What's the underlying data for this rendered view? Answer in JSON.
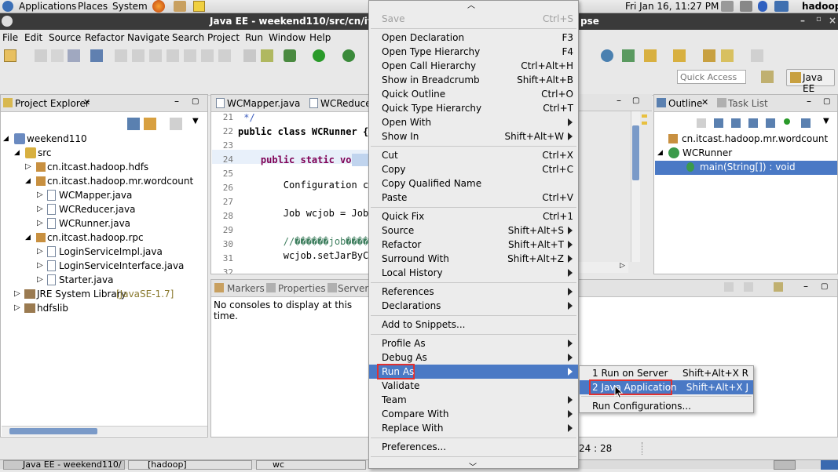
{
  "topbar": {
    "menus": [
      "Applications",
      "Places",
      "System"
    ],
    "datetime": "Fri Jan 16, 11:27 PM",
    "user": "hadoop"
  },
  "window": {
    "title_left": "Java EE - weekend110/src/cn/itcas",
    "title_right": "pse"
  },
  "menubar": [
    "File",
    "Edit",
    "Source",
    "Refactor",
    "Navigate",
    "Search",
    "Project",
    "Run",
    "Window",
    "Help"
  ],
  "toolbar": {
    "quick_access_placeholder": "Quick Access",
    "perspective": "Java EE"
  },
  "project_explorer": {
    "title": "Project Explorer",
    "items": [
      {
        "label": "weekend110"
      },
      {
        "label": "src"
      },
      {
        "label": "cn.itcast.hadoop.hdfs"
      },
      {
        "label": "cn.itcast.hadoop.mr.wordcount"
      },
      {
        "label": "WCMapper.java"
      },
      {
        "label": "WCReducer.java"
      },
      {
        "label": "WCRunner.java"
      },
      {
        "label": "cn.itcast.hadoop.rpc"
      },
      {
        "label": "LoginServiceImpl.java"
      },
      {
        "label": "LoginServiceInterface.java"
      },
      {
        "label": "Starter.java"
      },
      {
        "label": "JRE System Library",
        "suffix": "[JavaSE-1.7]"
      },
      {
        "label": "hdfslib"
      }
    ]
  },
  "editor": {
    "tabs": [
      "WCMapper.java",
      "WCReducer.ja"
    ],
    "lines": [
      {
        "no": "21",
        "text": " */"
      },
      {
        "no": "22",
        "text": "public class WCRunner {"
      },
      {
        "no": "23",
        "text": ""
      },
      {
        "no": "24",
        "text": "    public static void mai"
      },
      {
        "no": "25",
        "text": ""
      },
      {
        "no": "26",
        "text": "        Configuration conf"
      },
      {
        "no": "27",
        "text": ""
      },
      {
        "no": "28",
        "text": "        Job wcjob = Job.ge"
      },
      {
        "no": "29",
        "text": ""
      },
      {
        "no": "30",
        "text": "        //������job����"
      },
      {
        "no": "31",
        "text": "        wcjob.setJarByClas"
      },
      {
        "no": "32",
        "text": ""
      }
    ]
  },
  "bottom_panel": {
    "tabs": [
      "Markers",
      "Properties",
      "Servers"
    ],
    "message": "No consoles to display at this time."
  },
  "outline": {
    "tabs": [
      "Outline",
      "Task List"
    ],
    "items": [
      "cn.itcast.hadoop.mr.wordcount",
      "WCRunner",
      "main(String[]) : void"
    ]
  },
  "status": {
    "position": "24 : 28"
  },
  "taskbar": [
    "Java EE - weekend110/",
    "[hadoop]",
    "wc"
  ],
  "context_menu": {
    "items": [
      {
        "label": "Save",
        "shortcut": "Ctrl+S",
        "disabled": true
      },
      {
        "label": "Open Declaration",
        "shortcut": "F3"
      },
      {
        "label": "Open Type Hierarchy",
        "shortcut": "F4"
      },
      {
        "label": "Open Call Hierarchy",
        "shortcut": "Ctrl+Alt+H"
      },
      {
        "label": "Show in Breadcrumb",
        "shortcut": "Shift+Alt+B"
      },
      {
        "label": "Quick Outline",
        "shortcut": "Ctrl+O"
      },
      {
        "label": "Quick Type Hierarchy",
        "shortcut": "Ctrl+T"
      },
      {
        "label": "Open With",
        "shortcut": ""
      },
      {
        "label": "Show In",
        "shortcut": "Shift+Alt+W"
      },
      {
        "label": "Cut",
        "shortcut": "Ctrl+X"
      },
      {
        "label": "Copy",
        "shortcut": "Ctrl+C"
      },
      {
        "label": "Copy Qualified Name",
        "shortcut": ""
      },
      {
        "label": "Paste",
        "shortcut": "Ctrl+V"
      },
      {
        "label": "Quick Fix",
        "shortcut": "Ctrl+1"
      },
      {
        "label": "Source",
        "shortcut": "Shift+Alt+S"
      },
      {
        "label": "Refactor",
        "shortcut": "Shift+Alt+T"
      },
      {
        "label": "Surround With",
        "shortcut": "Shift+Alt+Z"
      },
      {
        "label": "Local History",
        "shortcut": ""
      },
      {
        "label": "References",
        "shortcut": ""
      },
      {
        "label": "Declarations",
        "shortcut": ""
      },
      {
        "label": "Add to Snippets...",
        "shortcut": ""
      },
      {
        "label": "Profile As",
        "shortcut": ""
      },
      {
        "label": "Debug As",
        "shortcut": ""
      },
      {
        "label": "Run As",
        "shortcut": ""
      },
      {
        "label": "Validate",
        "shortcut": ""
      },
      {
        "label": "Team",
        "shortcut": ""
      },
      {
        "label": "Compare With",
        "shortcut": ""
      },
      {
        "label": "Replace With",
        "shortcut": ""
      },
      {
        "label": "Preferences...",
        "shortcut": ""
      }
    ]
  },
  "submenu": {
    "items": [
      {
        "label": "1 Run on Server",
        "shortcut": "Shift+Alt+X R"
      },
      {
        "label": "2 Java Application",
        "shortcut": "Shift+Alt+X J"
      },
      {
        "label": "Run Configurations...",
        "shortcut": ""
      }
    ]
  },
  "colors": {
    "selection": "#4a79c5",
    "highlight_box": "#e03030",
    "keyword": "#7f0055"
  }
}
